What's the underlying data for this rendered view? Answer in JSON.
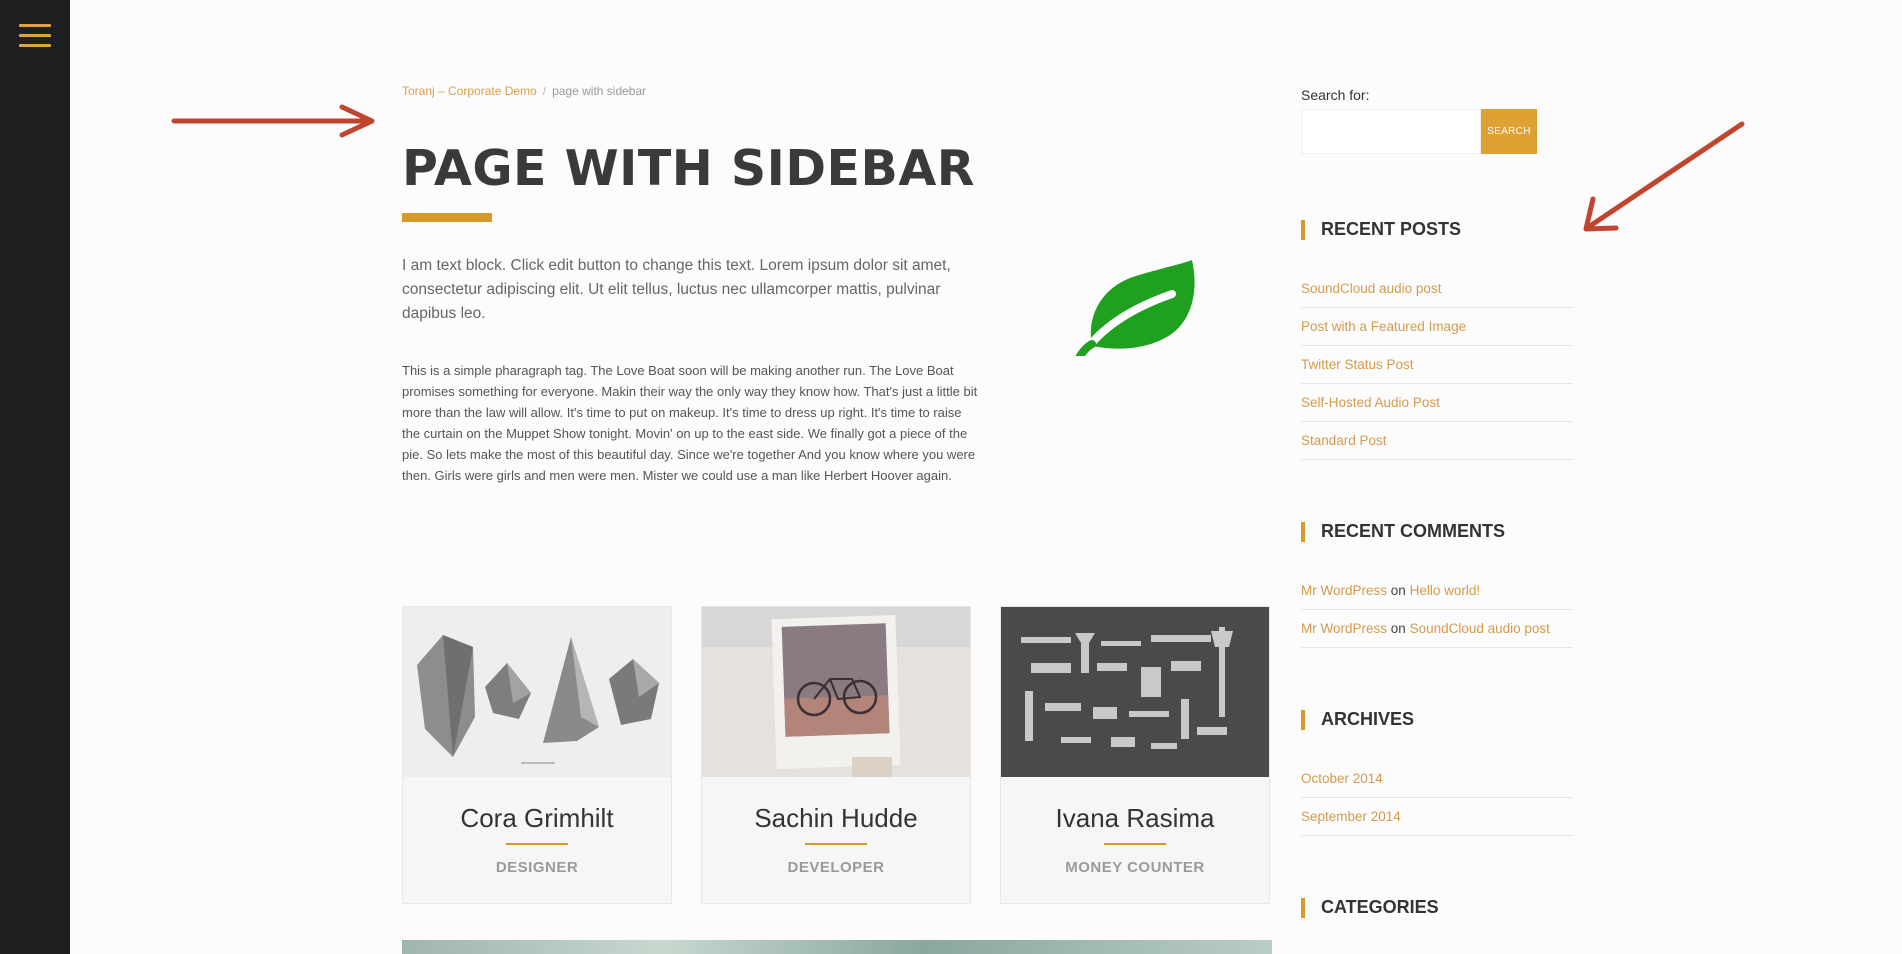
{
  "nav": {
    "menu_icon": "hamburger-icon"
  },
  "colors": {
    "accent": "#d79a2a",
    "link": "#d59a4a",
    "rail": "#1f1f1f",
    "annotation_arrow": "#c0452f",
    "leaf": "#1fa01f"
  },
  "breadcrumb": {
    "home": "Toranj – Corporate Demo",
    "separator": "/",
    "current": "page with sidebar"
  },
  "page": {
    "title": "PAGE WITH SIDEBAR",
    "lead": "I am text block. Click edit button to change this text. Lorem ipsum dolor sit amet, consectetur adipiscing elit. Ut elit tellus, luctus nec ullamcorper mattis, pulvinar dapibus leo.",
    "body": "This is a simple pharagraph tag. The Love Boat soon will be making another run. The Love Boat promises something for everyone. Makin their way the only way they know how. That's just a little bit more than the law will allow. It's time to put on makeup. It's time to dress up right. It's time to raise the curtain on the Muppet Show tonight. Movin' on up to the east side. We finally got a piece of the pie. So lets make the most of this beautiful day. Since we're together And you know where you were then. Girls were girls and men were men. Mister we could use a man like Herbert Hoover again.",
    "feature_icon": "leaf-icon"
  },
  "team": [
    {
      "name": "Cora Grimhilt",
      "role": "DESIGNER"
    },
    {
      "name": "Sachin Hudde",
      "role": "DEVELOPER"
    },
    {
      "name": "Ivana Rasima",
      "role": "MONEY COUNTER"
    }
  ],
  "sidebar": {
    "search": {
      "label": "Search for:",
      "placeholder": "",
      "button": "SEARCH"
    },
    "recent_posts": {
      "title": "RECENT POSTS",
      "items": [
        "SoundCloud audio post",
        "Post with a Featured Image",
        "Twitter Status Post",
        "Self-Hosted Audio Post",
        "Standard Post"
      ]
    },
    "recent_comments": {
      "title": "RECENT COMMENTS",
      "items": [
        {
          "author": "Mr WordPress",
          "joiner": "on",
          "post": "Hello world!"
        },
        {
          "author": "Mr WordPress",
          "joiner": "on",
          "post": "SoundCloud audio post"
        }
      ]
    },
    "archives": {
      "title": "ARCHIVES",
      "items": [
        "October 2014",
        "September 2014"
      ]
    },
    "categories": {
      "title": "CATEGORIES"
    }
  }
}
